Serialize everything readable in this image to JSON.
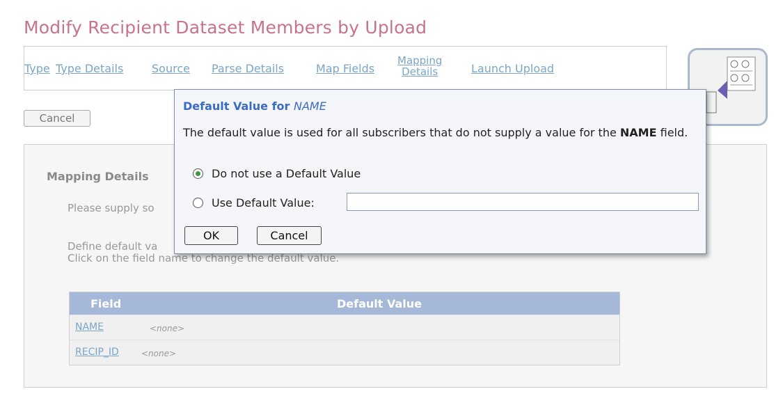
{
  "page": {
    "title": "Modify Recipient Dataset Members by Upload"
  },
  "steps": [
    {
      "label": "Type"
    },
    {
      "label": "Type Details"
    },
    {
      "label": "Source"
    },
    {
      "label": "Parse Details"
    },
    {
      "label": "Map Fields"
    },
    {
      "label_line1": "Mapping",
      "label_line2": "Details"
    },
    {
      "label": "Launch Upload"
    }
  ],
  "top_cancel_label": "Cancel",
  "section": {
    "title": "Mapping Details",
    "text1": "Please supply so",
    "text2_line1": "Define default va",
    "text2_line2": "Click on the field name to change the default value."
  },
  "table": {
    "headers": {
      "field": "Field",
      "default_value": "Default Value"
    },
    "rows": [
      {
        "field": "NAME",
        "value": "<none>"
      },
      {
        "field": "RECIP_ID",
        "value": "<none>"
      }
    ]
  },
  "dialog": {
    "title_prefix": "Default Value for ",
    "title_field": "NAME",
    "desc_prefix": "The default value is used for all subscribers that do not supply a value for the ",
    "desc_field": "NAME",
    "desc_suffix": " field.",
    "option_no_default": "Do not use a Default Value",
    "option_use_default": "Use Default Value:",
    "default_input_value": "",
    "ok_label": "OK",
    "cancel_label": "Cancel"
  },
  "colors": {
    "title": "#c8728d",
    "link": "#7aa6c8",
    "table_header": "#a5b8d8",
    "dialog_title": "#3a6bc5"
  },
  "icons": {
    "upload_icon": "dataset-upload-icon"
  }
}
